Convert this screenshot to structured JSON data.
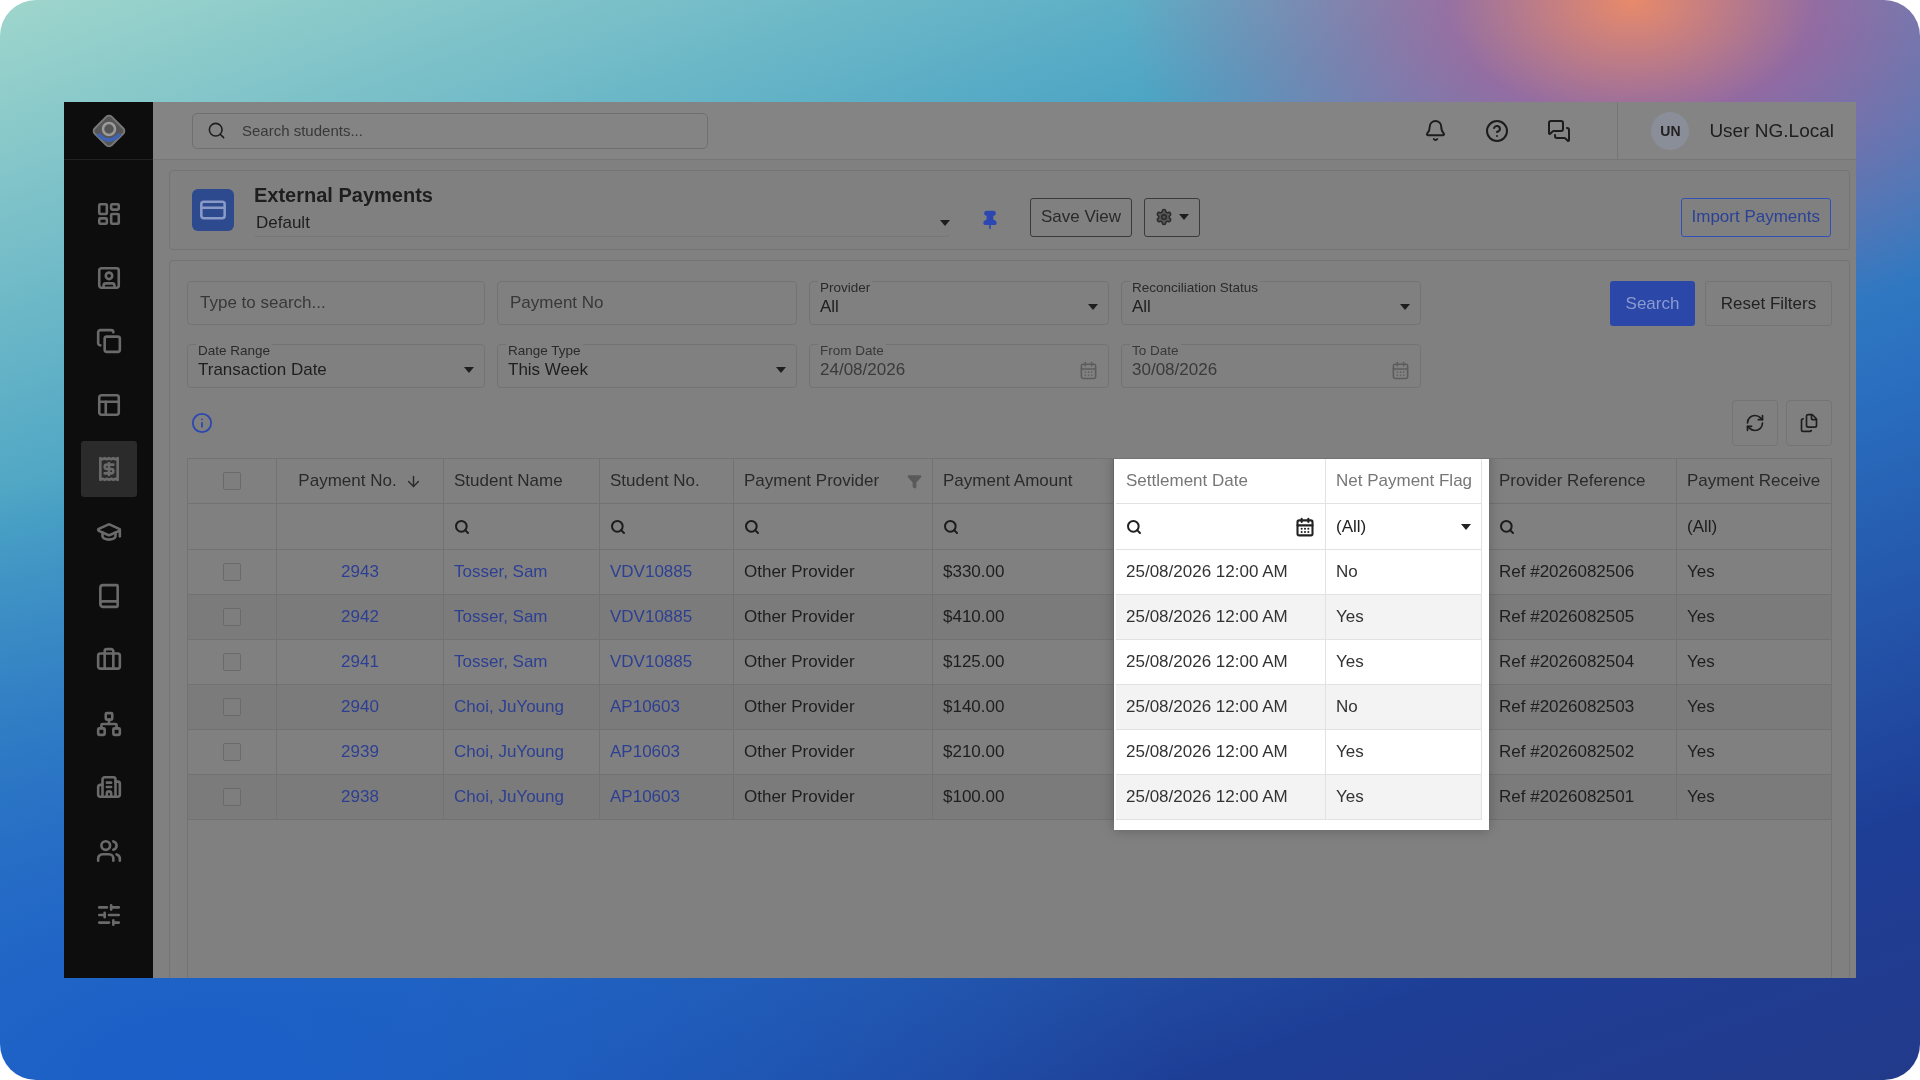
{
  "sidebar": {
    "items": [
      {
        "selected": false
      },
      {
        "selected": false
      },
      {
        "selected": false
      },
      {
        "selected": false
      },
      {
        "selected": true
      },
      {
        "selected": false
      },
      {
        "selected": false
      },
      {
        "selected": false
      },
      {
        "selected": false
      },
      {
        "selected": false
      },
      {
        "selected": false
      },
      {
        "selected": false
      }
    ]
  },
  "topbar": {
    "search": {
      "placeholder": "Search students..."
    },
    "user": {
      "initials": "UN",
      "name": "User NG.Local"
    }
  },
  "page_header": {
    "title": "External Payments",
    "view": "Default",
    "save_button": "Save View",
    "import_button": "Import Payments"
  },
  "filters": {
    "fields": [
      {
        "kind": "text",
        "placeholder": "Type to search..."
      },
      {
        "kind": "text",
        "placeholder": "Payment No"
      },
      {
        "kind": "select",
        "label": "Provider",
        "value": "All",
        "disabled": false
      },
      {
        "kind": "select",
        "label": "Reconciliation Status",
        "value": "All",
        "disabled": false
      },
      {
        "kind": "select",
        "label": "Date Range",
        "value": "Transaction Date",
        "disabled": false
      },
      {
        "kind": "select",
        "label": "Range Type",
        "value": "This Week",
        "disabled": false
      },
      {
        "kind": "date",
        "label": "From Date",
        "value": "24/08/2026",
        "disabled": true
      },
      {
        "kind": "date",
        "label": "To Date",
        "value": "30/08/2026",
        "disabled": true
      }
    ],
    "search_button": "Search",
    "reset_button": "Reset Filters"
  },
  "table": {
    "select_all": {
      "checked": false
    },
    "columns": [
      {
        "label": "Payment No.",
        "sorted": true,
        "filtered": false,
        "highlighted": false,
        "link": true,
        "filter": {
          "kind": "none"
        }
      },
      {
        "label": "Student Name",
        "sorted": false,
        "filtered": false,
        "highlighted": false,
        "link": true,
        "filter": {
          "kind": "search"
        }
      },
      {
        "label": "Student No.",
        "sorted": false,
        "filtered": false,
        "highlighted": false,
        "link": true,
        "filter": {
          "kind": "search"
        }
      },
      {
        "label": "Payment Provider",
        "sorted": false,
        "filtered": true,
        "highlighted": false,
        "link": false,
        "filter": {
          "kind": "search"
        }
      },
      {
        "label": "Payment Amount",
        "sorted": false,
        "filtered": false,
        "highlighted": false,
        "link": false,
        "filter": {
          "kind": "search"
        }
      },
      {
        "label": "Settlement Date",
        "sorted": false,
        "filtered": false,
        "highlighted": true,
        "link": false,
        "filter": {
          "kind": "date"
        }
      },
      {
        "label": "Net Payment Flag",
        "sorted": false,
        "filtered": false,
        "highlighted": true,
        "link": false,
        "filter": {
          "kind": "select",
          "value": "(All)"
        }
      },
      {
        "label": "Provider Reference",
        "sorted": false,
        "filtered": false,
        "highlighted": false,
        "link": false,
        "filter": {
          "kind": "search"
        }
      },
      {
        "label": "Payment Receive",
        "highlighted": false,
        "link": false,
        "filter": {
          "kind": "text",
          "value": "(All)"
        }
      }
    ],
    "rows": [
      {
        "checked": false,
        "cells": [
          "2943",
          "Tosser, Sam",
          "VDV10885",
          "Other Provider",
          "$330.00",
          "25/08/2026 12:00 AM",
          "No",
          "Ref #2026082506",
          "Yes"
        ]
      },
      {
        "checked": false,
        "cells": [
          "2942",
          "Tosser, Sam",
          "VDV10885",
          "Other Provider",
          "$410.00",
          "25/08/2026 12:00 AM",
          "Yes",
          "Ref #2026082505",
          "Yes"
        ]
      },
      {
        "checked": false,
        "cells": [
          "2941",
          "Tosser, Sam",
          "VDV10885",
          "Other Provider",
          "$125.00",
          "25/08/2026 12:00 AM",
          "Yes",
          "Ref #2026082504",
          "Yes"
        ]
      },
      {
        "checked": false,
        "cells": [
          "2940",
          "Choi, JuYoung",
          "AP10603",
          "Other Provider",
          "$140.00",
          "25/08/2026 12:00 AM",
          "No",
          "Ref #2026082503",
          "Yes"
        ]
      },
      {
        "checked": false,
        "cells": [
          "2939",
          "Choi, JuYoung",
          "AP10603",
          "Other Provider",
          "$210.00",
          "25/08/2026 12:00 AM",
          "Yes",
          "Ref #2026082502",
          "Yes"
        ]
      },
      {
        "checked": false,
        "cells": [
          "2938",
          "Choi, JuYoung",
          "AP10603",
          "Other Provider",
          "$100.00",
          "25/08/2026 12:00 AM",
          "Yes",
          "Ref #2026082501",
          "Yes"
        ]
      }
    ]
  }
}
